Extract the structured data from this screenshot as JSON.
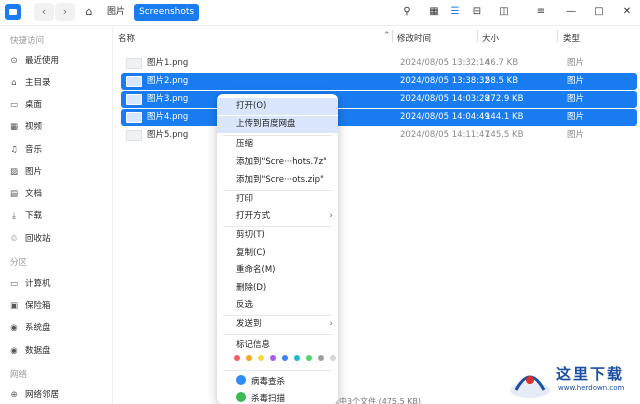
{
  "toolbar": {
    "back": "‹",
    "forward": "›",
    "home_glyph": "⌂",
    "breadcrumb": [
      "图片",
      "Screenshots"
    ],
    "icons": [
      "search-icon",
      "grid-view-icon",
      "list-view-icon",
      "tree-view-icon",
      "detail-panel-icon",
      "menu-icon",
      "minimize-icon",
      "maximize-icon",
      "close-icon"
    ],
    "glyphs": {
      "search": "⚲",
      "grid": "▦",
      "list": "☰",
      "tree": "⊟",
      "panel": "◫",
      "menu": "≡",
      "min": "—",
      "max": "□",
      "close": "✕"
    }
  },
  "sidebar": {
    "quick_access": "快捷访问",
    "items": [
      {
        "label": "最近使用",
        "icon": "⊙"
      },
      {
        "label": "主目录",
        "icon": "⌂"
      },
      {
        "label": "桌面",
        "icon": "▭"
      },
      {
        "label": "视频",
        "icon": "▦"
      },
      {
        "label": "音乐",
        "icon": "♫"
      },
      {
        "label": "图片",
        "icon": "▨"
      },
      {
        "label": "文档",
        "icon": "▤"
      },
      {
        "label": "下载",
        "icon": "⤓"
      },
      {
        "label": "回收站",
        "icon": "♲"
      }
    ],
    "partitions": "分区",
    "partition_items": [
      {
        "label": "计算机",
        "icon": "▭"
      },
      {
        "label": "保险箱",
        "icon": "▣"
      },
      {
        "label": "系统盘",
        "icon": "◉"
      },
      {
        "label": "数据盘",
        "icon": "◉"
      }
    ],
    "network": "网络",
    "network_items": [
      {
        "label": "网络邻居",
        "icon": "⊕"
      }
    ]
  },
  "columns": {
    "name": "名称",
    "mtime": "修改时间",
    "size": "大小",
    "type": "类型"
  },
  "files": [
    {
      "name": "图片1.png",
      "mtime": "2024/08/05 13:32:14",
      "size": "46.7 KB",
      "type": "图片",
      "selected": false
    },
    {
      "name": "图片2.png",
      "mtime": "2024/08/05 13:38:32",
      "size": "58.5 KB",
      "type": "图片",
      "selected": true
    },
    {
      "name": "图片3.png",
      "mtime": "2024/08/05 14:03:28",
      "size": "272.9 KB",
      "type": "图片",
      "selected": true
    },
    {
      "name": "图片4.png",
      "mtime": "2024/08/05 14:04:49",
      "size": "144.1 KB",
      "type": "图片",
      "selected": true
    },
    {
      "name": "图片5.png",
      "mtime": "2024/08/05 14:11:47",
      "size": "145.5 KB",
      "type": "图片",
      "selected": false
    }
  ],
  "status": "已选中3个文件 (475.5 KB)",
  "context_menu": {
    "items": [
      {
        "label": "打开(O)",
        "submenu": false
      },
      {
        "label": "上传到百度网盘",
        "submenu": false
      },
      {
        "label": "压缩",
        "submenu": false
      },
      {
        "label": "添加到\"Scre···hots.7z\"",
        "submenu": false
      },
      {
        "label": "添加到\"Scre···ots.zip\"",
        "submenu": false
      },
      {
        "label": "打印",
        "submenu": false
      },
      {
        "label": "打开方式",
        "submenu": true
      },
      {
        "label": "剪切(T)",
        "submenu": false
      },
      {
        "label": "复制(C)",
        "submenu": false
      },
      {
        "label": "重命名(M)",
        "submenu": false
      },
      {
        "label": "删除(D)",
        "submenu": false
      },
      {
        "label": "反选",
        "submenu": false
      },
      {
        "label": "发送到",
        "submenu": true
      }
    ],
    "tag_label": "标记信息",
    "tag_colors": [
      "#f25f5c",
      "#f5a623",
      "#f8d93b",
      "#a55eea",
      "#3b82f6",
      "#1fb8d6",
      "#4cd964",
      "#9e9e9e",
      "#d6d6d6"
    ],
    "extra_items": [
      {
        "label": "病毒查杀",
        "icon_color": "#2f8df5"
      },
      {
        "label": "杀毒扫描",
        "icon_color": "#3cba54"
      }
    ],
    "submenu_arrow": "›"
  },
  "watermark": {
    "text": "这里下载",
    "url": "www.herdown.com"
  }
}
